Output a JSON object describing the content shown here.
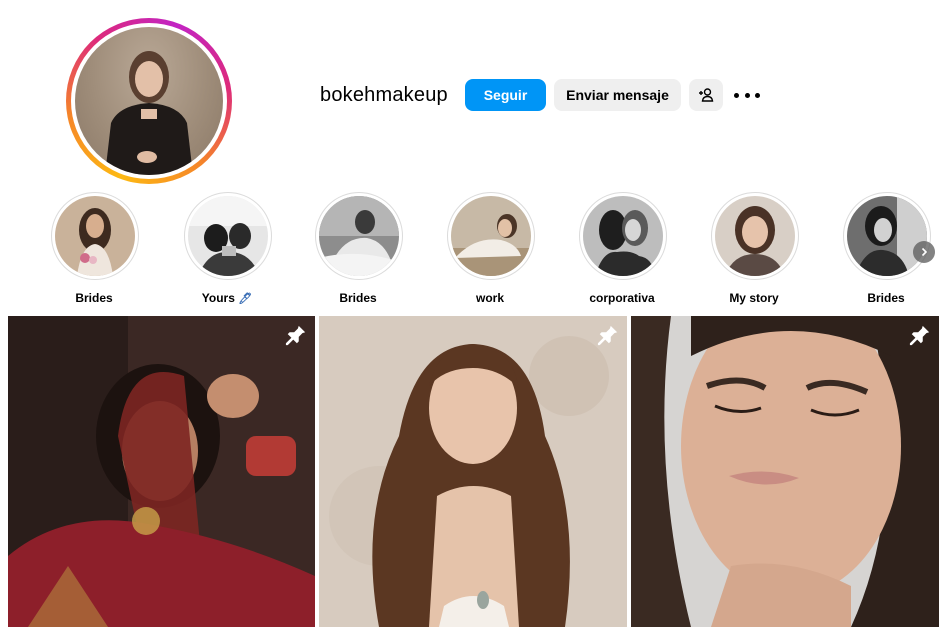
{
  "profile": {
    "username": "bokehmakeup",
    "follow_label": "Seguir",
    "message_label": "Enviar mensaje",
    "suggest_icon": "person-add-icon",
    "more_icon": "more-options-icon"
  },
  "highlights": [
    {
      "label": "Brides"
    },
    {
      "label": "Yours",
      "emoji": "🖊"
    },
    {
      "label": "Brides"
    },
    {
      "label": "work"
    },
    {
      "label": "corporativa"
    },
    {
      "label": "My story"
    },
    {
      "label": "Brides"
    }
  ],
  "posts": [
    {
      "pinned": true,
      "pin_icon": "pin-icon"
    },
    {
      "pinned": true,
      "pin_icon": "pin-icon"
    },
    {
      "pinned": true,
      "pin_icon": "pin-icon"
    }
  ],
  "colors": {
    "accent": "#0095f6",
    "button_gray": "#efefef"
  }
}
